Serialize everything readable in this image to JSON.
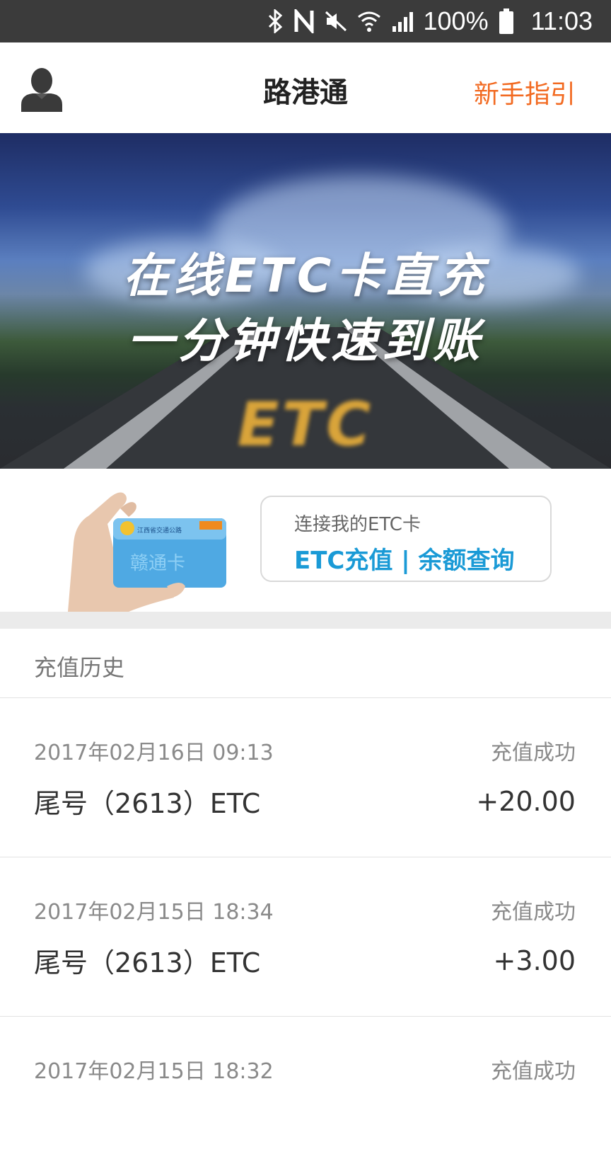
{
  "status_bar": {
    "icons": [
      "bluetooth-icon",
      "nfc-icon",
      "mute-icon",
      "wifi-icon",
      "signal-icon",
      "battery-icon"
    ],
    "battery": "100%",
    "time": "11:03"
  },
  "header": {
    "title": "路港通",
    "guide_label": "新手指引",
    "avatar_icon": "user-avatar-icon",
    "accent_color": "#f26a21"
  },
  "banner": {
    "line1": "在线ETC卡直充",
    "line2": "一分钟快速到账",
    "road_text": "ETC"
  },
  "card_section": {
    "card_image_text": "赣通卡",
    "connect_label": "连接我的ETC卡",
    "action_label": "ETC充值 | 余额查询",
    "action_color": "#1a9ad6"
  },
  "history": {
    "title": "充值历史",
    "records": [
      {
        "date": "2017年02月16日 09:13",
        "status": "充值成功",
        "card": "尾号（2613）ETC",
        "amount": "+20.00"
      },
      {
        "date": "2017年02月15日 18:34",
        "status": "充值成功",
        "card": "尾号（2613）ETC",
        "amount": "+3.00"
      },
      {
        "date": "2017年02月15日 18:32",
        "status": "充值成功",
        "card": "",
        "amount": ""
      }
    ]
  }
}
